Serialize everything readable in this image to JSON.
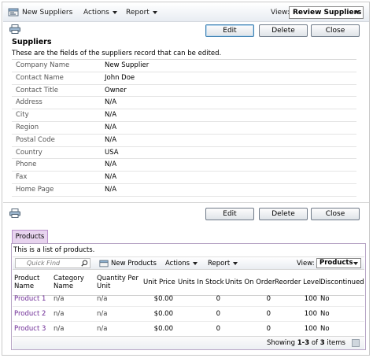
{
  "toolbar": {
    "new_label": "New Suppliers",
    "actions_label": "Actions",
    "report_label": "Report",
    "view_label": "View:",
    "view_value": "Review Suppliers"
  },
  "form_buttons": {
    "edit": "Edit",
    "delete": "Delete",
    "close": "Close"
  },
  "suppliers": {
    "title": "Suppliers",
    "description": "These are the fields of the suppliers record that can be edited.",
    "fields": [
      {
        "label": "Company Name",
        "value": "New Supplier"
      },
      {
        "label": "Contact Name",
        "value": "John Doe"
      },
      {
        "label": "Contact Title",
        "value": "Owner"
      },
      {
        "label": "Address",
        "value": "N/A"
      },
      {
        "label": "City",
        "value": "N/A"
      },
      {
        "label": "Region",
        "value": "N/A"
      },
      {
        "label": "Postal Code",
        "value": "N/A"
      },
      {
        "label": "Country",
        "value": "USA"
      },
      {
        "label": "Phone",
        "value": "N/A"
      },
      {
        "label": "Fax",
        "value": "N/A"
      },
      {
        "label": "Home Page",
        "value": "N/A"
      }
    ]
  },
  "products": {
    "tab_label": "Products",
    "description": "This is a list of products.",
    "quick_find_placeholder": "Quick Find",
    "new_label": "New Products",
    "actions_label": "Actions",
    "report_label": "Report",
    "view_label": "View:",
    "view_value": "Products",
    "columns": {
      "product_name": [
        "Product",
        "Name"
      ],
      "category_name": [
        "Category",
        "Name"
      ],
      "quantity_per_unit": [
        "Quantity Per",
        "Unit"
      ],
      "unit_price": "Unit Price",
      "units_in_stock": "Units In Stock",
      "units_on_order": "Units On Order",
      "reorder_level": "Reorder Level",
      "discontinued": "Discontinued"
    },
    "rows": [
      {
        "name": "Product 1",
        "category": "n/a",
        "qpu": "n/a",
        "price": "$0.00",
        "stock": "0",
        "order": "0",
        "reorder": "100",
        "disc": "No"
      },
      {
        "name": "Product 2",
        "category": "n/a",
        "qpu": "n/a",
        "price": "$0.00",
        "stock": "0",
        "order": "0",
        "reorder": "100",
        "disc": "No"
      },
      {
        "name": "Product 3",
        "category": "n/a",
        "qpu": "n/a",
        "price": "$0.00",
        "stock": "0",
        "order": "0",
        "reorder": "100",
        "disc": "No"
      }
    ],
    "pager": {
      "prefix": "Showing ",
      "range": "1-3",
      "middle": " of ",
      "total": "3",
      "suffix": " items"
    }
  },
  "colors": {
    "link": "#6e2b96",
    "tab_bg": "#e8d4ef",
    "accent_border": "#3c7fb1"
  }
}
